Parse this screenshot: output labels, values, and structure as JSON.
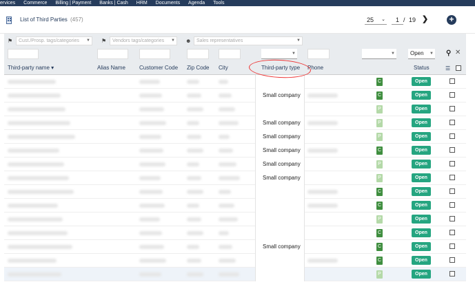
{
  "topnav": [
    "ervices",
    "Commerce",
    "Billing | Payment",
    "Banks | Cash",
    "HRM",
    "Documents",
    "Agenda",
    "Tools"
  ],
  "page": {
    "title": "List of Third Parties",
    "count": "(457)",
    "per_page": "25",
    "current_page": "1",
    "separator": "/",
    "total_pages": "19",
    "next_icon": "chevron-right-icon",
    "add_icon": "plus-circle-icon"
  },
  "filters": {
    "customer_tags_placeholder": "Cust./Prosp. tags/categories",
    "vendor_tags_placeholder": "Vendors tags/categories",
    "sales_rep_placeholder": "Sales representatives",
    "status_value": "Open"
  },
  "columns": {
    "name": "Third-party name",
    "alias": "Alias Name",
    "customer_code": "Customer Code",
    "zip": "Zip Code",
    "city": "City",
    "type": "Third-party type",
    "phone": "Phone",
    "status": "Status"
  },
  "rows": [
    {
      "type": "",
      "badge": "C",
      "status": "Open"
    },
    {
      "type": "Small company",
      "badge": "C",
      "status": "Open"
    },
    {
      "type": "",
      "badge": "P",
      "status": "Open"
    },
    {
      "type": "Small company",
      "badge": "P",
      "status": "Open"
    },
    {
      "type": "Small company",
      "badge": "P",
      "status": "Open"
    },
    {
      "type": "Small company",
      "badge": "C",
      "status": "Open"
    },
    {
      "type": "Small company",
      "badge": "P",
      "status": "Open"
    },
    {
      "type": "Small company",
      "badge": "P",
      "status": "Open"
    },
    {
      "type": "",
      "badge": "C",
      "status": "Open"
    },
    {
      "type": "",
      "badge": "C",
      "status": "Open"
    },
    {
      "type": "",
      "badge": "P",
      "status": "Open"
    },
    {
      "type": "",
      "badge": "C",
      "status": "Open"
    },
    {
      "type": "Small company",
      "badge": "C",
      "status": "Open"
    },
    {
      "type": "",
      "badge": "C",
      "status": "Open"
    },
    {
      "type": "",
      "badge": "P",
      "status": "Open"
    }
  ],
  "colors": {
    "nav_bg": "#263c5c",
    "status_open": "#25a580",
    "badge_customer": "#3f8e3f",
    "badge_prospect": "#b4d9a8",
    "annotation_circle": "#e33333"
  }
}
